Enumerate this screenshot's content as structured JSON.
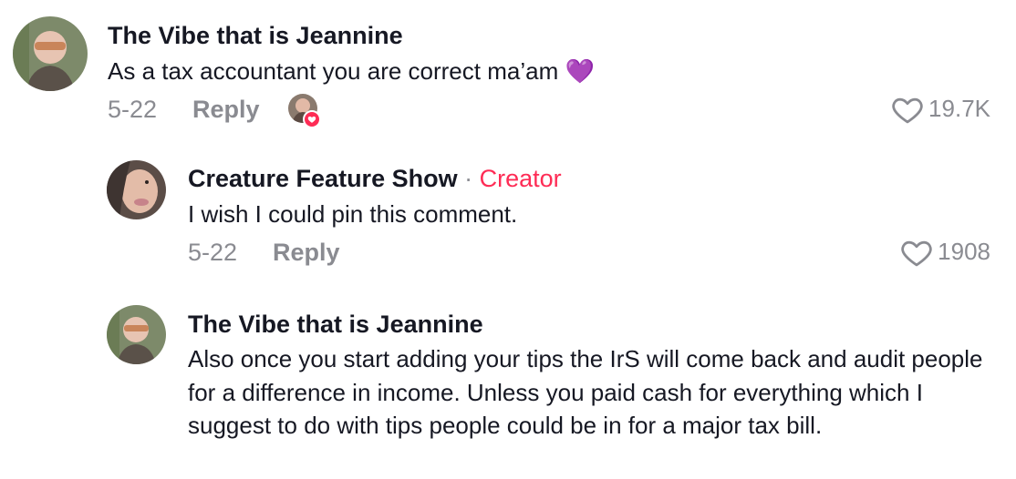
{
  "comments": [
    {
      "author": "The Vibe that is Jeannine",
      "text": "As a tax accountant you are correct ma’am",
      "emoji": "💜",
      "date": "5-22",
      "reply_label": "Reply",
      "like_count": "19.7K",
      "liked_by_creator": true
    },
    {
      "author": "Creature Feature Show",
      "separator": "·",
      "badge": "Creator",
      "text": "I wish I could pin this comment.",
      "date": "5-22",
      "reply_label": "Reply",
      "like_count": "1908"
    },
    {
      "author": "The Vibe that is Jeannine",
      "text": "Also once you start adding your tips the IrS will come back and audit people for a difference in income. Unless you paid cash for everything which I suggest to do with tips people could be in for a major tax bill."
    }
  ],
  "icons": {
    "like": "heart-outline-icon",
    "liked_by_creator_badge": "heart-filled-icon"
  },
  "colors": {
    "accent": "#fe2c55",
    "muted_text": "#8a8b91",
    "primary_text": "#161823"
  }
}
